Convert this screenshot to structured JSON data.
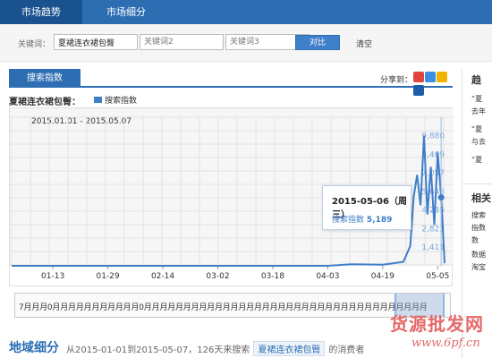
{
  "topnav": {
    "tabs": [
      {
        "label": "市场趋势"
      },
      {
        "label": "市场细分"
      }
    ]
  },
  "keywords": {
    "label": "关键词：",
    "kw1_value": "夏裙连衣裙包臀",
    "kw2_placeholder": "关键词2",
    "kw3_placeholder": "关键词3",
    "compare_label": "对比",
    "clear_label": "清空"
  },
  "panel": {
    "tab_label": "搜索指数",
    "share_label": "分享到："
  },
  "chart_header": {
    "title": "夏裙连衣裙包臀：",
    "legend": "搜索指数"
  },
  "chart_data": {
    "type": "line",
    "date_range_label": "2015.01.01 - 2015.05.07",
    "x_ticks": [
      "01-13",
      "01-29",
      "02-14",
      "03-02",
      "03-18",
      "04-03",
      "04-19",
      "05-05"
    ],
    "y_ticks": [
      1411,
      2823,
      4235,
      5646,
      7057,
      8469,
      9880
    ],
    "y_tick_labels": [
      "1,411",
      "2,823",
      "4,235",
      "5,646",
      "7,057",
      "8,469",
      "9,880"
    ],
    "ylim": [
      0,
      11000
    ],
    "series": [
      {
        "name": "搜索指数",
        "x": [
          "2015-01-01",
          "2015-01-13",
          "2015-01-29",
          "2015-02-14",
          "2015-03-02",
          "2015-03-18",
          "2015-04-03",
          "2015-04-10",
          "2015-04-19",
          "2015-04-25",
          "2015-04-27",
          "2015-04-28",
          "2015-04-29",
          "2015-04-30",
          "2015-05-01",
          "2015-05-02",
          "2015-05-03",
          "2015-05-04",
          "2015-05-05",
          "2015-05-06",
          "2015-05-07"
        ],
        "values": [
          0,
          0,
          0,
          0,
          0,
          0,
          0,
          120,
          90,
          300,
          1500,
          5200,
          6900,
          4600,
          9880,
          3900,
          7500,
          3100,
          8600,
          5189,
          200
        ]
      }
    ],
    "grid": true,
    "tooltip": {
      "date": "2015-05-06（周三）",
      "label": "搜索指数",
      "value": "5,189"
    }
  },
  "range_bar": {
    "text": "7月月月0月月月月月月月月月月月0月月月月月月月月月月月月月月月月月月月月月月月月月月月月月月月月月月月月"
  },
  "region": {
    "title": "地域细分",
    "desc_prefix": "从2015-01-01到2015-05-07，126天来搜索",
    "keyword": "夏裙连衣裙包臀",
    "desc_suffix": "的消费者"
  },
  "sidebar": {
    "heading": "趋",
    "items": [
      "“夏",
      "去年",
      "“夏",
      "与去",
      "“夏"
    ],
    "heading2": "相关",
    "items2": [
      "搜索",
      "指数",
      "数",
      "数据",
      "淘宝"
    ]
  },
  "watermark": {
    "main": "货源批发网",
    "sub": "www.6pf.cn"
  },
  "colors": {
    "brand": "#2d6eb3",
    "line": "#3f7ec9",
    "watermark": "#e46a6a"
  }
}
